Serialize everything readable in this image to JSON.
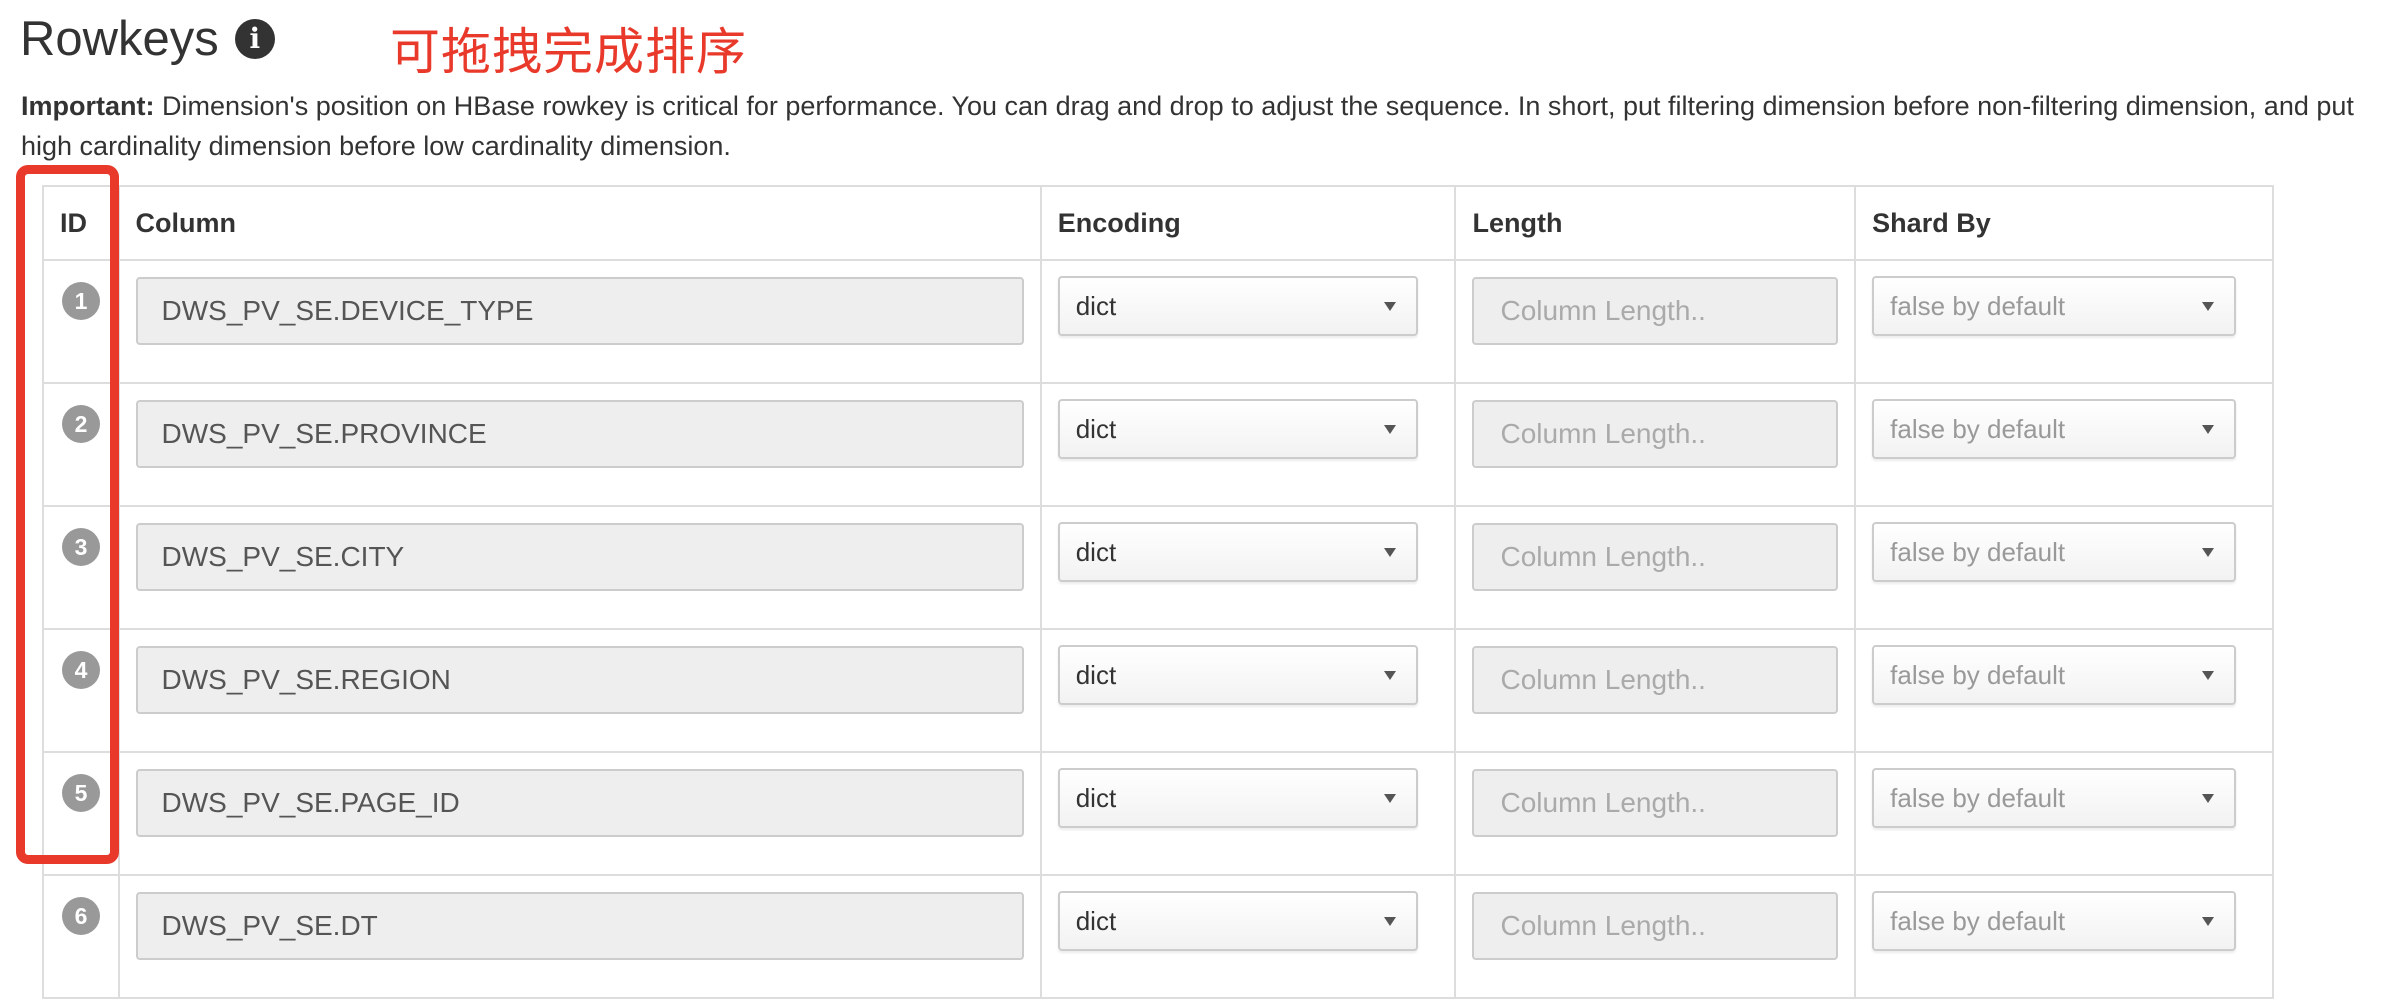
{
  "section": {
    "title": "Rowkeys",
    "info_icon": "info-circle-icon"
  },
  "annotation": {
    "text": "可拖拽完成排序",
    "color": "#e8392b"
  },
  "note": {
    "label": "Important:",
    "text": "Dimension's position on HBase rowkey is critical for performance. You can drag and drop to adjust the sequence. In short, put filtering dimension before non-filtering dimension, and put high cardinality dimension before low cardinality dimension."
  },
  "table": {
    "headers": {
      "id": "ID",
      "column": "Column",
      "encoding": "Encoding",
      "length": "Length",
      "shard_by": "Shard By"
    },
    "rows": [
      {
        "id": "1",
        "column": "DWS_PV_SE.DEVICE_TYPE",
        "encoding": "dict",
        "length_placeholder": "Column Length..",
        "shard_by": "false by default"
      },
      {
        "id": "2",
        "column": "DWS_PV_SE.PROVINCE",
        "encoding": "dict",
        "length_placeholder": "Column Length..",
        "shard_by": "false by default"
      },
      {
        "id": "3",
        "column": "DWS_PV_SE.CITY",
        "encoding": "dict",
        "length_placeholder": "Column Length..",
        "shard_by": "false by default"
      },
      {
        "id": "4",
        "column": "DWS_PV_SE.REGION",
        "encoding": "dict",
        "length_placeholder": "Column Length..",
        "shard_by": "false by default"
      },
      {
        "id": "5",
        "column": "DWS_PV_SE.PAGE_ID",
        "encoding": "dict",
        "length_placeholder": "Column Length..",
        "shard_by": "false by default"
      },
      {
        "id": "6",
        "column": "DWS_PV_SE.DT",
        "encoding": "dict",
        "length_placeholder": "Column Length..",
        "shard_by": "false by default"
      }
    ]
  }
}
